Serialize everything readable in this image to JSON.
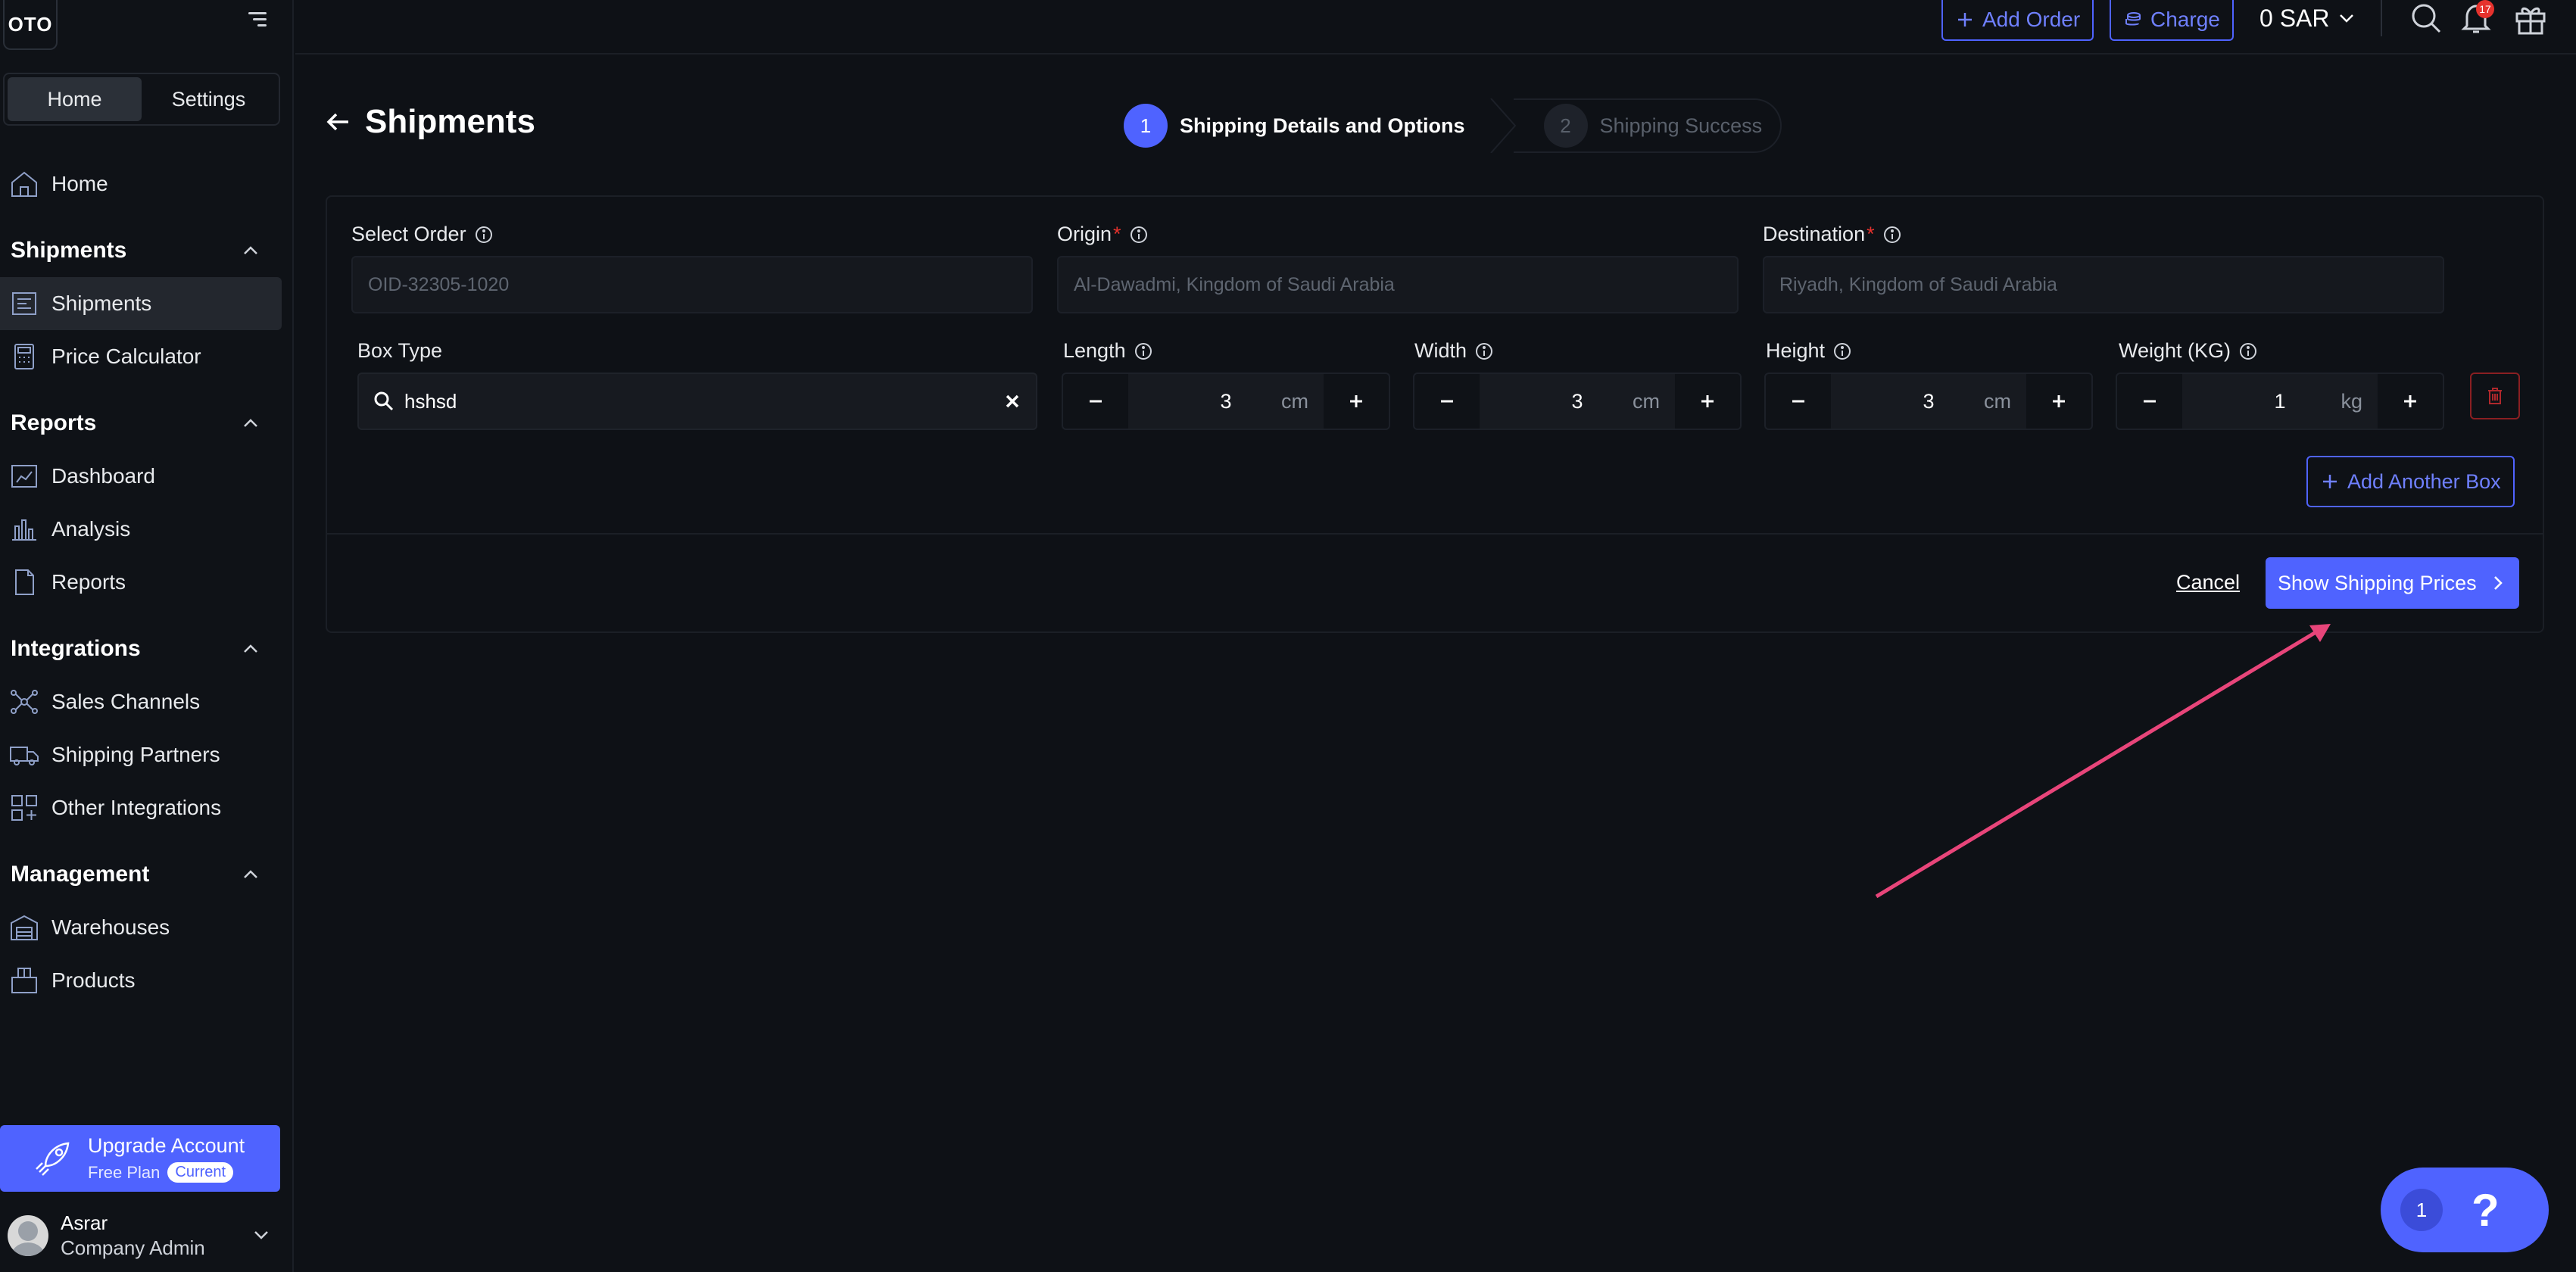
{
  "logo": "OTO",
  "sidebar": {
    "segments": [
      "Home",
      "Settings"
    ],
    "home_item": "Home",
    "sections": [
      {
        "title": "Shipments",
        "items": [
          "Shipments",
          "Price Calculator"
        ]
      },
      {
        "title": "Reports",
        "items": [
          "Dashboard",
          "Analysis",
          "Reports"
        ]
      },
      {
        "title": "Integrations",
        "items": [
          "Sales Channels",
          "Shipping Partners",
          "Other Integrations"
        ]
      },
      {
        "title": "Management",
        "items": [
          "Warehouses",
          "Products"
        ]
      }
    ],
    "upgrade": {
      "title": "Upgrade Account",
      "plan": "Free Plan",
      "badge": "Current"
    },
    "user": {
      "name": "Asrar",
      "role": "Company Admin"
    }
  },
  "topbar": {
    "add_order": "Add Order",
    "charge": "Charge",
    "balance": "0 SAR",
    "notifications": "17"
  },
  "page": {
    "title": "Shipments",
    "steps": [
      {
        "num": "1",
        "label": "Shipping Details and Options"
      },
      {
        "num": "2",
        "label": "Shipping Success"
      }
    ]
  },
  "form": {
    "select_order_label": "Select Order",
    "select_order_value": "OID-32305-1020",
    "origin_label": "Origin",
    "origin_value": "Al-Dawadmi, Kingdom of Saudi Arabia",
    "destination_label": "Destination",
    "destination_value": "Riyadh, Kingdom of Saudi Arabia",
    "required_mark": "*",
    "box_type_label": "Box Type",
    "box_type_value": "hshsd",
    "length": {
      "label": "Length",
      "value": "3",
      "unit": "cm"
    },
    "width": {
      "label": "Width",
      "value": "3",
      "unit": "cm"
    },
    "height": {
      "label": "Height",
      "value": "3",
      "unit": "cm"
    },
    "weight": {
      "label": "Weight (KG)",
      "value": "1",
      "unit": "kg"
    },
    "add_another_box": "Add Another Box",
    "cancel": "Cancel",
    "show_prices": "Show Shipping Prices"
  },
  "help": {
    "count": "1",
    "symbol": "?"
  },
  "colors": {
    "accent": "#4f63ff",
    "background": "#0e1116",
    "danger": "#e5322d",
    "annotation": "#e8457a"
  }
}
